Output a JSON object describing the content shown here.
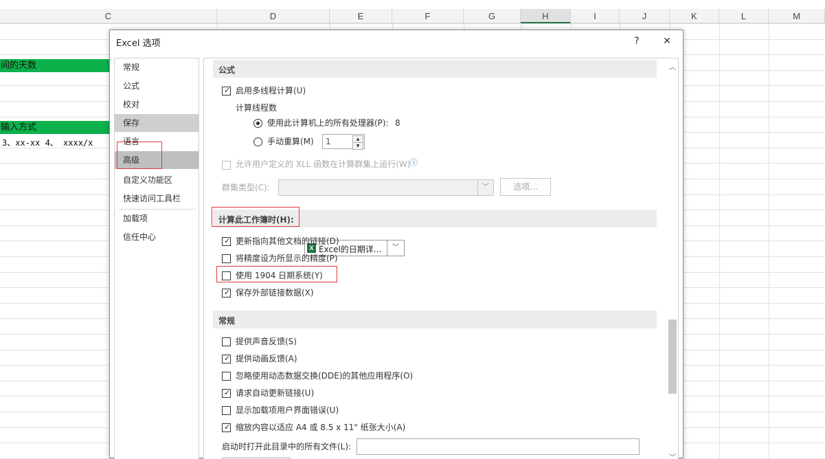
{
  "sheet": {
    "columns": [
      "C",
      "D",
      "E",
      "F",
      "G",
      "H",
      "I",
      "J",
      "K",
      "L",
      "M"
    ],
    "selected_column": "H",
    "cells": {
      "c_row3": "间的天数",
      "c_row6": "输入方式",
      "c_row7": "3、xx-xx  4、 xxxx/x"
    }
  },
  "dialog": {
    "title": "Excel 选项",
    "help_label": "?",
    "close_label": "✕"
  },
  "nav": {
    "items": [
      "常规",
      "公式",
      "校对",
      "保存",
      "语言",
      "高级",
      "自定义功能区",
      "快速访问工具栏",
      "加载项",
      "信任中心"
    ],
    "selected": "高级"
  },
  "content": {
    "sections": {
      "formulas": "公式",
      "calc_workbook": "计算此工作簿时(H):",
      "general": "常规"
    },
    "multithread": {
      "label": "启用多线程计算(U)",
      "checked": true
    },
    "threads_label": "计算线程数",
    "use_all_processors": {
      "label": "使用此计算机上的所有处理器(P):",
      "count": "8",
      "selected": true
    },
    "manual_threads": {
      "label": "手动重算(M)",
      "value": "1",
      "selected": false
    },
    "xll": {
      "label": "允许用户定义的 XLL 函数在计算群集上运行(W)",
      "info_icon": "ⓘ",
      "checked": false,
      "enabled": false
    },
    "cluster_type": {
      "label": "群集类型(C):",
      "value": "",
      "button": "选项..."
    },
    "workbook_select": {
      "value": "Excel的日期详...",
      "icon": "excel-icon"
    },
    "calc_options": [
      {
        "label": "更新指向其他文档的链接(D)",
        "checked": true
      },
      {
        "label": "将精度设为所显示的精度(P)",
        "checked": false
      },
      {
        "label": "使用 1904 日期系统(Y)",
        "checked": false
      },
      {
        "label": "保存外部链接数据(X)",
        "checked": true
      }
    ],
    "general_options": [
      {
        "label": "提供声音反馈(S)",
        "checked": false
      },
      {
        "label": "提供动画反馈(A)",
        "checked": true
      },
      {
        "label": "忽略使用动态数据交换(DDE)的其他应用程序(O)",
        "checked": false
      },
      {
        "label": "请求自动更新链接(U)",
        "checked": true
      },
      {
        "label": "显示加载项用户界面错误(U)",
        "checked": false
      },
      {
        "label": "缩放内容以适应 A4 或 8.5 x 11\" 纸张大小(A)",
        "checked": true
      }
    ],
    "startup_folder": {
      "label": "启动时打开此目录中的所有文件(L):",
      "value": ""
    }
  },
  "colors": {
    "accent_green": "#0db14b",
    "excel_green": "#1e7145",
    "highlight_red": "#e23a3a"
  }
}
